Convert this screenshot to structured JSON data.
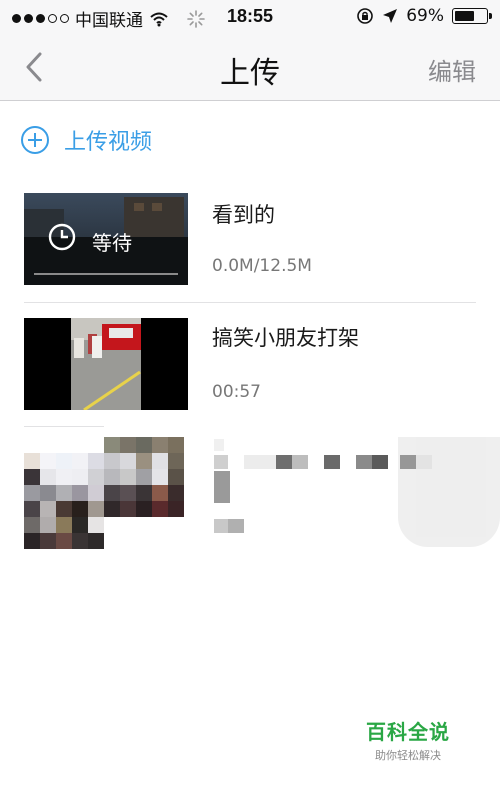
{
  "status_bar": {
    "carrier": "中国联通",
    "time": "18:55",
    "battery_percent": "69%",
    "battery_level": 0.69,
    "signal_dots_filled": 3,
    "signal_dots_total": 5
  },
  "nav": {
    "title": "上传",
    "back_icon": "chevron-left-icon",
    "edit_label": "编辑"
  },
  "upload": {
    "label": "上传视频",
    "icon": "plus-circle-icon",
    "accent": "#3a9ee6"
  },
  "videos": [
    {
      "title": "看到的",
      "status_label": "等待",
      "subtitle": "0.0M/12.5M",
      "thumb_icon": "clock-icon"
    },
    {
      "title": "搞笑小朋友打架",
      "subtitle": "00:57"
    },
    {
      "title": "",
      "subtitle": "",
      "blurred": true
    }
  ],
  "watermark": {
    "brand": "百科全说",
    "tagline": "助你轻松解决",
    "color": "#2aa745"
  }
}
